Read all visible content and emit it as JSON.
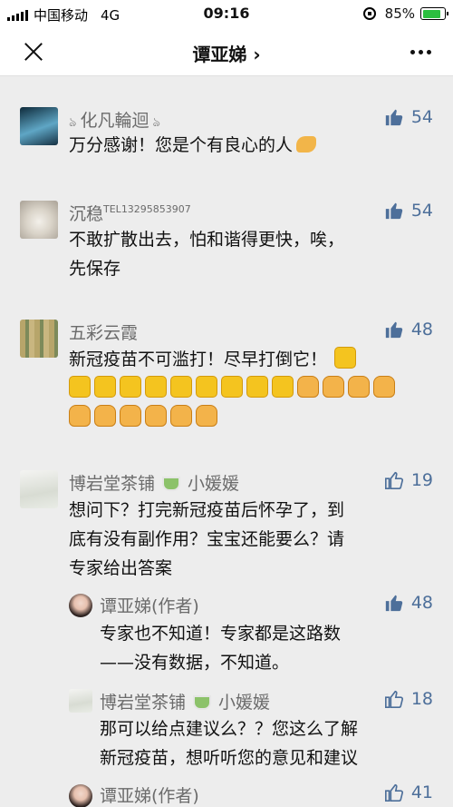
{
  "status_bar": {
    "carrier": "中国移动",
    "network": "4G",
    "time": "09:16",
    "battery": "85%",
    "battery_level": 0.85
  },
  "nav": {
    "title": "谭亚娣 ›"
  },
  "colors": {
    "like_blue": "#4d6f9a",
    "name_gray": "#6b6b6b",
    "background": "#ededed"
  },
  "comments": [
    {
      "name": "化凡輪迴",
      "likes": "54",
      "lines": [
        "万分感谢！您是个有良心的人"
      ]
    },
    {
      "name": "沉稳",
      "name_suffix": "TEL13295853907",
      "likes": "54",
      "lines": [
        "不敢扩散出去，怕和谐得更快，唉，",
        "先保存"
      ]
    },
    {
      "name": "五彩云霞",
      "likes": "48",
      "lines": [
        "新冠疫苗不可滥打！尽早打倒它！"
      ]
    },
    {
      "name": "博岩堂茶铺",
      "name_suffix": "小媛媛",
      "likes": "19",
      "lines": [
        "想问下？打完新冠疫苗后怀孕了，到",
        "底有没有副作用？宝宝还能要么？请",
        "专家给出答案"
      ]
    },
    {
      "name": "谭亚娣(作者)",
      "likes": "48",
      "lines": [
        "专家也不知道！专家都是这路数",
        "——没有数据，不知道。"
      ]
    },
    {
      "name": "博岩堂茶铺",
      "name_suffix": "小媛媛",
      "likes": "18",
      "lines": [
        "那可以给点建议么？？您这么了解",
        "新冠疫苗，想听听您的意见和建议"
      ]
    },
    {
      "name": "谭亚娣(作者)",
      "likes": "41",
      "lines": []
    }
  ]
}
